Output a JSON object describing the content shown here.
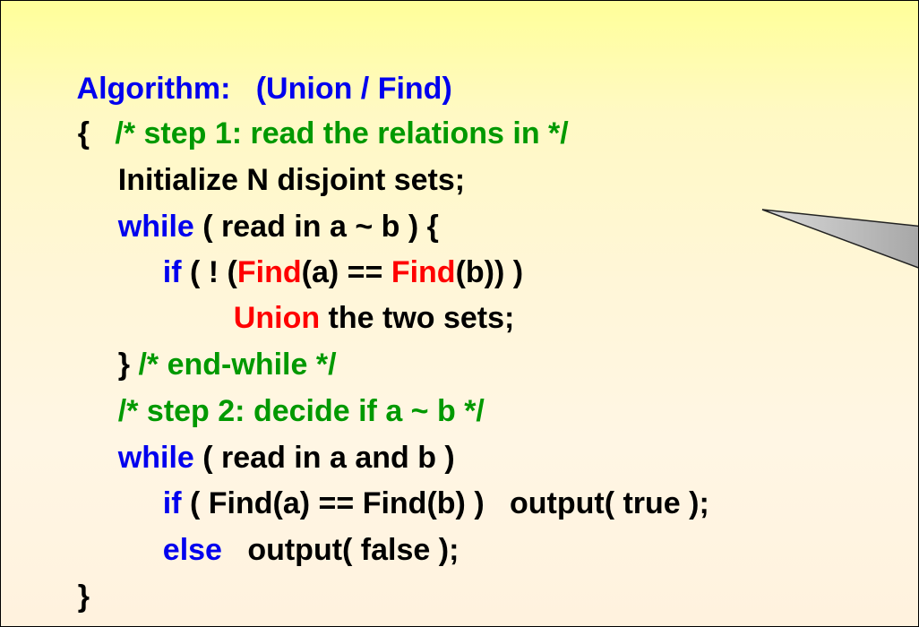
{
  "title": {
    "label": "Algorithm:",
    "subtitle": "(Union / Find)"
  },
  "code": {
    "l1_brace": "{",
    "l1_comment": "/* step 1: read the relations in */",
    "l2_text": "Initialize N disjoint sets;",
    "l3_kw": "while",
    "l3_text": " ( read in a ~ b ) {",
    "l4_kw": "if",
    "l4_a": " ( ! (",
    "l4_find1": "Find",
    "l4_b": "(a) == ",
    "l4_find2": "Find",
    "l4_c": "(b)) )",
    "l5_union": "Union",
    "l5_text": " the two sets;",
    "l6_text": "} ",
    "l6_comment": "/* end-while */",
    "l7_comment": "/* step 2: decide if a ~ b */",
    "l8_kw": "while",
    "l8_text": " ( read in a and b )",
    "l9_kw": "if",
    "l9_text": " ( Find(a) == Find(b) )   output( true );",
    "l10_kw": "else",
    "l10_text": "   output( false );",
    "l11_brace": "}"
  },
  "colors": {
    "keyword": "#0000ee",
    "comment": "#009900",
    "highlight": "#ff0000",
    "text": "#000000",
    "background": "#fff6d8"
  }
}
